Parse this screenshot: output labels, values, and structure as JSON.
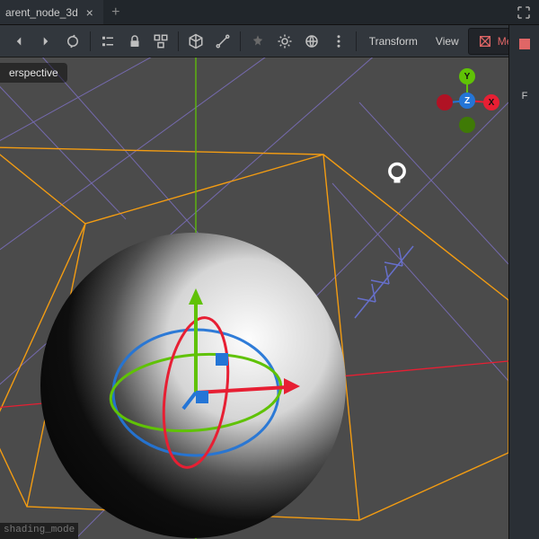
{
  "tab_title": "arent_node_3d",
  "perspective_label": "erspective",
  "toolbar": {
    "transform_label": "Transform",
    "view_label": "View",
    "mesh_label": "Mesh"
  },
  "status_text": "shading_mode",
  "axis_gizmo": {
    "x": "X",
    "y": "Y",
    "z": "Z"
  },
  "right_panel": {
    "item1": "",
    "item2_prefix": "F"
  },
  "colors": {
    "axis_x": "#e71f33",
    "axis_y": "#60c206",
    "axis_z": "#2475d6",
    "orange": "#f39c12",
    "mesh_accent": "#e06666"
  }
}
